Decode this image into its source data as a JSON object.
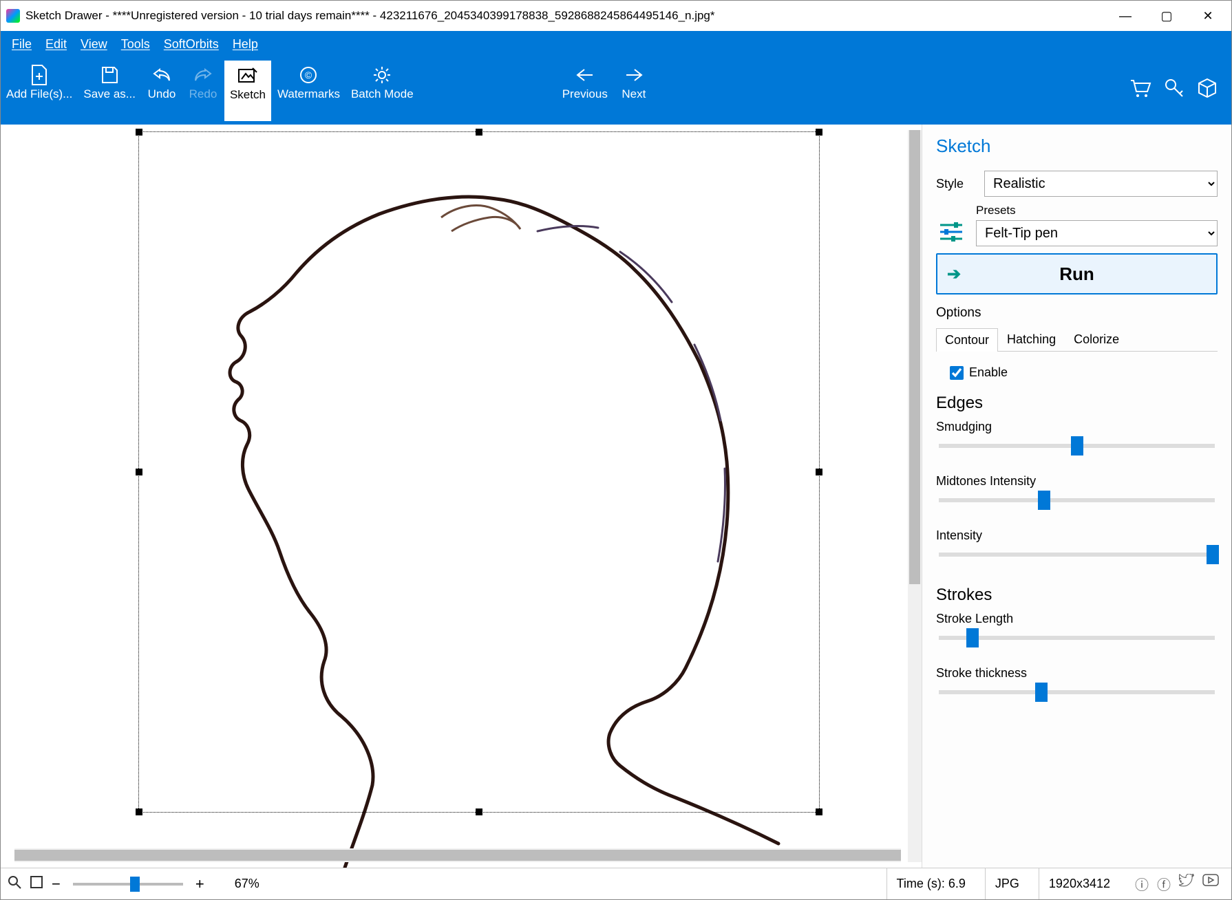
{
  "window": {
    "title": "Sketch Drawer - ****Unregistered version - 10 trial days remain**** - 423211676_2045340399178838_5928688245864495146_n.jpg*"
  },
  "menu": {
    "file": "File",
    "edit": "Edit",
    "view": "View",
    "tools": "Tools",
    "softorbits": "SoftOrbits",
    "help": "Help"
  },
  "toolbar": {
    "add": "Add File(s)...",
    "save": "Save as...",
    "undo": "Undo",
    "redo": "Redo",
    "sketch": "Sketch",
    "watermarks": "Watermarks",
    "batch": "Batch Mode",
    "previous": "Previous",
    "next": "Next"
  },
  "panel": {
    "title": "Sketch",
    "style_label": "Style",
    "style_value": "Realistic",
    "presets_label": "Presets",
    "presets_value": "Felt-Tip pen",
    "run": "Run",
    "options": "Options",
    "tabs": {
      "contour": "Contour",
      "hatching": "Hatching",
      "colorize": "Colorize"
    },
    "enable": "Enable",
    "edges_title": "Edges",
    "sliders": {
      "smudging": {
        "label": "Smudging",
        "value": 48
      },
      "midtones": {
        "label": "Midtones Intensity",
        "value": 36
      },
      "intensity": {
        "label": "Intensity",
        "value": 98
      }
    },
    "strokes_title": "Strokes",
    "strokes": {
      "length": {
        "label": "Stroke Length",
        "value": 10
      },
      "thickness": {
        "label": "Stroke thickness",
        "value": 35
      }
    }
  },
  "status": {
    "zoom": "67%",
    "time": "Time (s): 6.9",
    "format": "JPG",
    "dims": "1920x3412"
  }
}
